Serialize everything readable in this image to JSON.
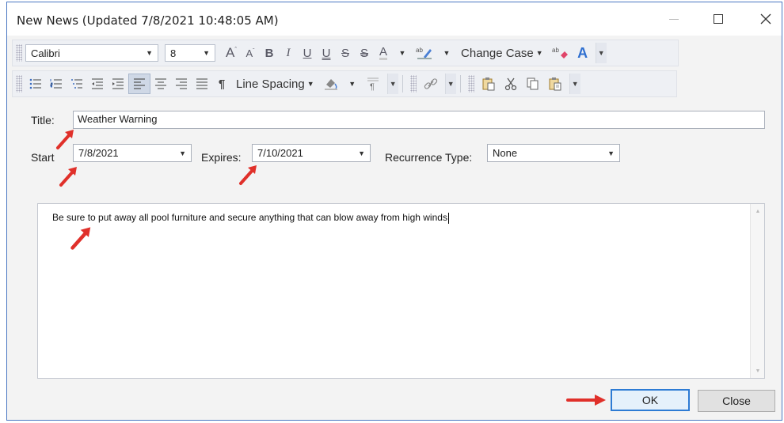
{
  "window": {
    "title": "New News (Updated 7/8/2021 10:48:05 AM)"
  },
  "toolbar1": {
    "font_name": "Calibri",
    "font_size": "8",
    "change_case_label": "Change Case"
  },
  "toolbar2": {
    "line_spacing_label": "Line Spacing"
  },
  "form": {
    "title_label": "Title:",
    "title_value": "Weather Warning",
    "start_label": "Start",
    "start_value": "7/8/2021",
    "expires_label": "Expires:",
    "expires_value": "7/10/2021",
    "recurrence_label": "Recurrence Type:",
    "recurrence_value": "None",
    "body_text": "Be sure to put away all pool furniture and secure anything that can blow away from high winds"
  },
  "buttons": {
    "ok_label": "OK",
    "close_label": "Close"
  },
  "colors": {
    "window_border": "#4a78c2",
    "annotation_arrow": "#e0302a",
    "ok_border": "#2d7bd4"
  },
  "icons": {
    "grow_font": "grow-font-icon",
    "shrink_font": "shrink-font-icon",
    "bold": "bold-icon",
    "italic": "italic-icon",
    "underline": "underline-icon",
    "double_underline": "double-underline-icon",
    "strikethrough": "strikethrough-icon",
    "double_strikethrough": "double-strikethrough-icon",
    "font_color": "font-color-icon",
    "highlight": "highlight-icon",
    "clear_format": "clear-format-icon",
    "text_effect": "text-effect-icon"
  }
}
